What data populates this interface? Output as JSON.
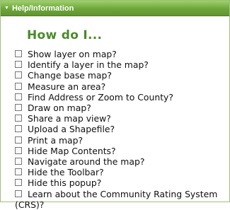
{
  "panel": {
    "title": "Help/Information",
    "heading": "How do I...",
    "items": [
      "Show layer on map?",
      "Identify a layer in the map?",
      "Change base map?",
      "Measure an area?",
      "Find Address or Zoom to County?",
      "Draw on map?",
      "Share a map view?",
      "Upload a Shapefile?",
      "Print a map?",
      "Hide Map Contents?",
      "Navigate around the map?",
      "Hide the Toolbar?",
      "Hide this popup?",
      "Learn about the Community Rating System"
    ],
    "last_item_wrap": "(CRS)?"
  },
  "colors": {
    "titlebar": "#6fa63a",
    "heading": "#4a8a2a"
  }
}
